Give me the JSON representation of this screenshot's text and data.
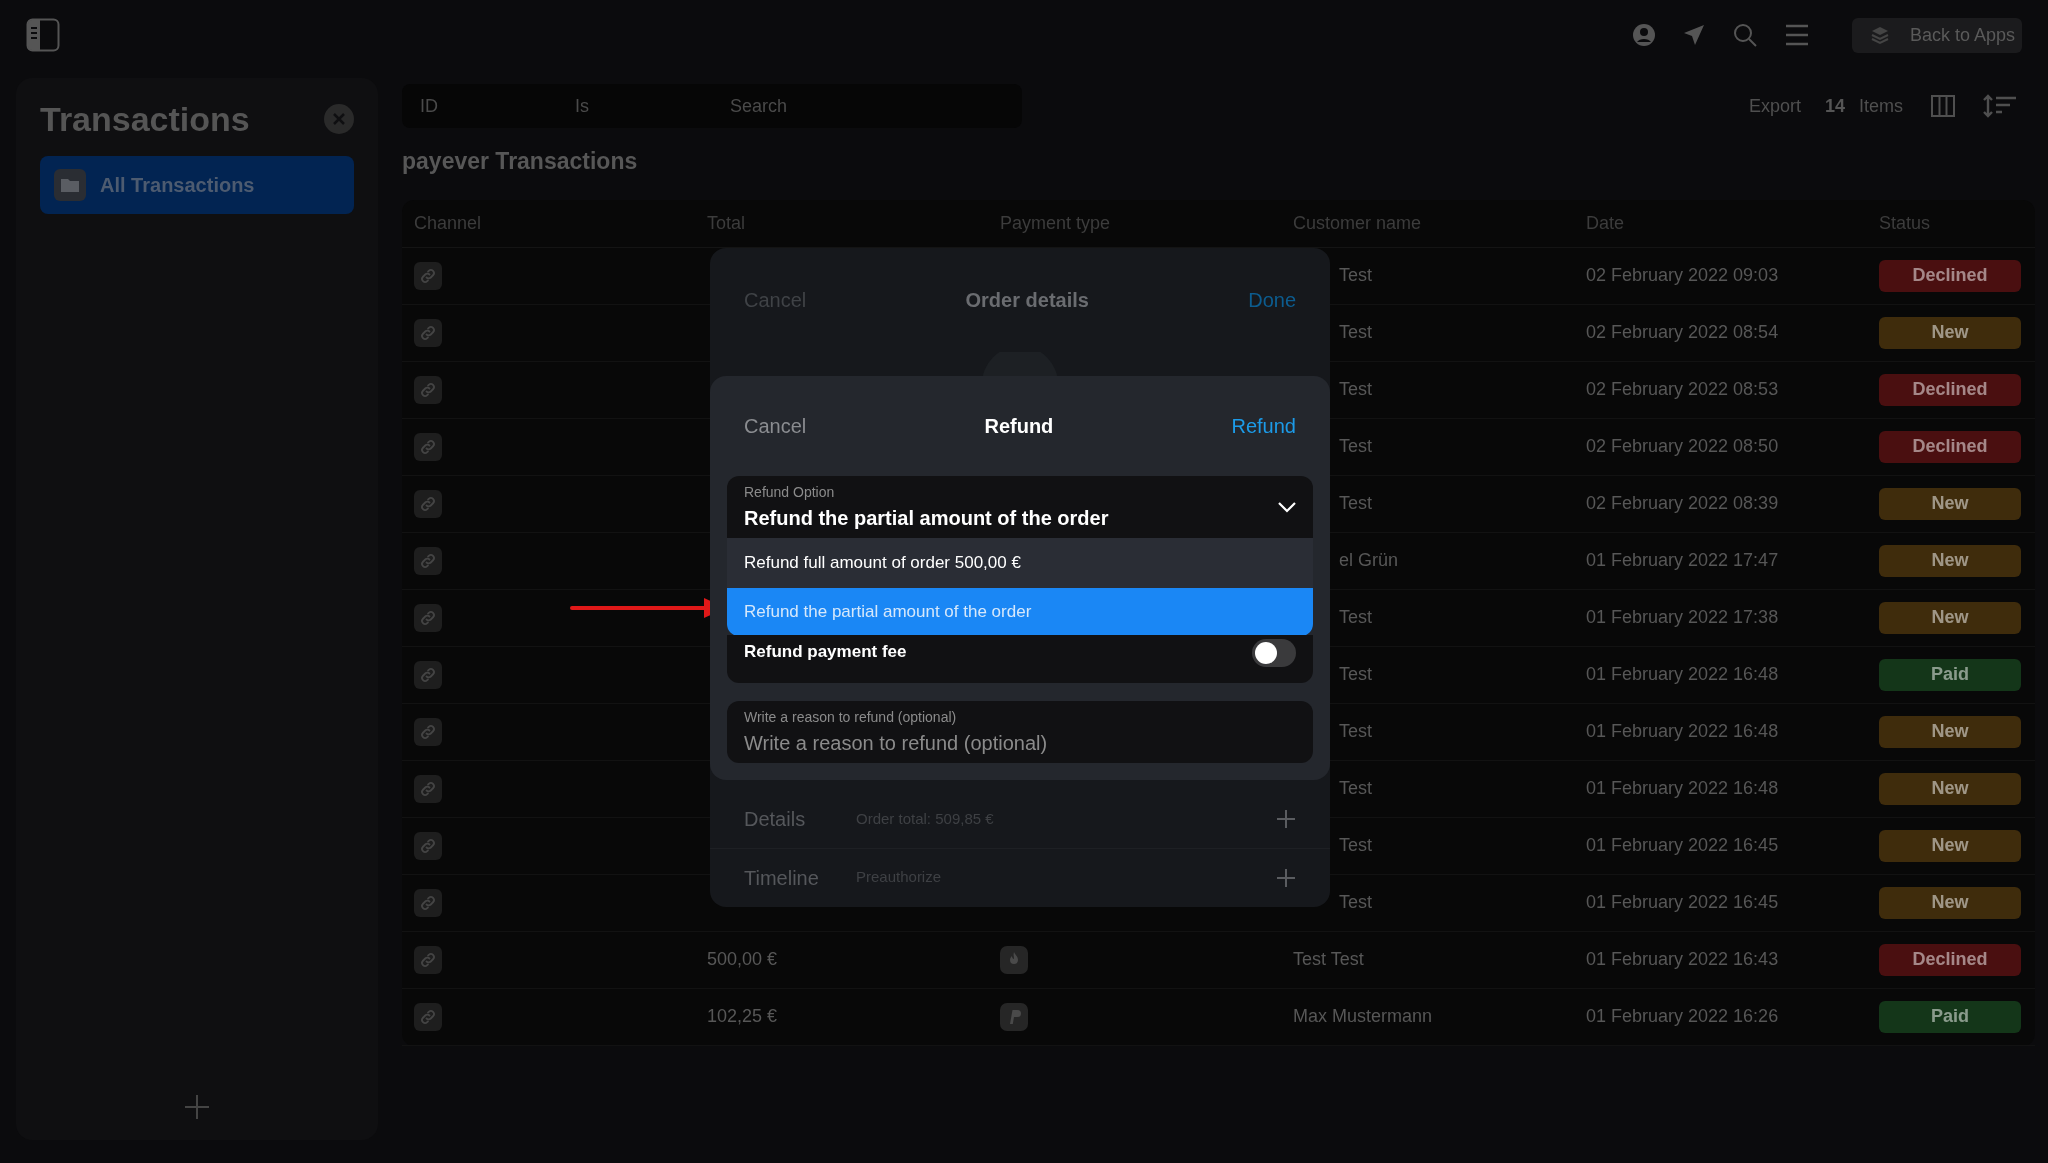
{
  "topbar": {
    "back_button": "Back to Apps"
  },
  "sidebar": {
    "title": "Transactions",
    "items": [
      {
        "label": "All Transactions",
        "selected": true
      }
    ]
  },
  "filters": [
    {
      "placeholder": "ID"
    },
    {
      "placeholder": "Is"
    },
    {
      "placeholder": "Search"
    }
  ],
  "toolbar": {
    "export": "Export",
    "count": "14",
    "count_label": "Items"
  },
  "table": {
    "title": "payever Transactions",
    "columns": [
      "Channel",
      "Total",
      "Payment type",
      "Customer name",
      "Date",
      "Status"
    ],
    "rows": [
      {
        "customer_tail": "Test",
        "date": "02 February 2022 09:03",
        "status": "Declined",
        "color": "#4a0f10"
      },
      {
        "customer_tail": "Test",
        "date": "02 February 2022 08:54",
        "status": "New",
        "color": "#3f2c0c"
      },
      {
        "customer_tail": "Test",
        "date": "02 February 2022 08:53",
        "status": "Declined",
        "color": "#4a0f10"
      },
      {
        "customer_tail": "Test",
        "date": "02 February 2022 08:50",
        "status": "Declined",
        "color": "#4a0f10"
      },
      {
        "customer_tail": "Test",
        "date": "02 February 2022 08:39",
        "status": "New",
        "color": "#3f2c0c"
      },
      {
        "customer_tail": "el Grün",
        "date": "01 February 2022 17:47",
        "status": "New",
        "color": "#3f2c0c"
      },
      {
        "customer_tail": "Test",
        "date": "01 February 2022 17:38",
        "status": "New",
        "color": "#3f2c0c"
      },
      {
        "customer_tail": "Test",
        "date": "01 February 2022 16:48",
        "status": "Paid",
        "color": "#143619"
      },
      {
        "customer_tail": "Test",
        "date": "01 February 2022 16:48",
        "status": "New",
        "color": "#3f2c0c"
      },
      {
        "customer_tail": "Test",
        "date": "01 February 2022 16:48",
        "status": "New",
        "color": "#3f2c0c"
      },
      {
        "customer_tail": "Test",
        "date": "01 February 2022 16:45",
        "status": "New",
        "color": "#3f2c0c"
      },
      {
        "customer_tail": "Test",
        "date": "01 February 2022 16:45",
        "status": "New",
        "color": "#3f2c0c"
      },
      {
        "total": "500,00 €",
        "payment": {
          "kind": "flame"
        },
        "customer": "Test Test",
        "date": "01 February 2022 16:43",
        "status": "Declined",
        "color": "#4a0f10"
      },
      {
        "total": "102,25 €",
        "payment": {
          "kind": "p-mark"
        },
        "customer": "Max Mustermann",
        "date": "01 February 2022 16:26",
        "status": "Paid",
        "color": "#143619"
      }
    ]
  },
  "order_details": {
    "cancel": "Cancel",
    "title": "Order details",
    "done": "Done",
    "sections": [
      {
        "label": "Details",
        "summary": "Order total: 509,85 €"
      },
      {
        "label": "Timeline",
        "summary": "Preauthorize"
      }
    ]
  },
  "refund": {
    "cancel": "Cancel",
    "title": "Refund",
    "confirm": "Refund",
    "option_field": {
      "label": "Refund Option",
      "value": "Refund the partial amount of the order",
      "expanded": true
    },
    "options": [
      {
        "label": "Refund full amount of order 500,00 €",
        "selected": false
      },
      {
        "label": "Refund the partial amount of the order",
        "selected": true
      }
    ],
    "fee": {
      "label": "Refund payment fee",
      "on": false
    },
    "reason": {
      "label": "Write a reason to refund (optional)",
      "placeholder": "Write a reason to refund (optional)"
    }
  }
}
